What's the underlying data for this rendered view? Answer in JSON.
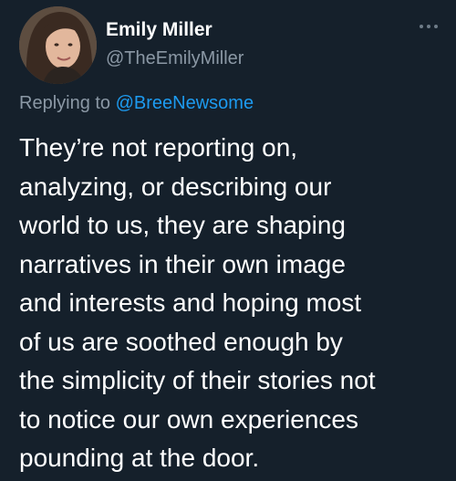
{
  "author": {
    "display_name": "Emily Miller",
    "handle": "@TheEmilyMiller",
    "avatar_icon": "profile-photo"
  },
  "menu": {
    "icon": "more-horizontal-icon"
  },
  "reply": {
    "prefix": "Replying to ",
    "mention": "@BreeNewsome"
  },
  "tweet": {
    "lines": [
      "They’re not reporting on,",
      "analyzing, or describing our",
      "world to us, they are shaping",
      "narratives in their own image",
      "and interests and hoping most",
      "of us are soothed enough by",
      "the simplicity of their stories not",
      "to notice our own experiences",
      "pounding at the door."
    ]
  },
  "colors": {
    "background": "#15202b",
    "text_primary": "#ffffff",
    "text_secondary": "#8b98a5",
    "link": "#1d9bf0"
  }
}
